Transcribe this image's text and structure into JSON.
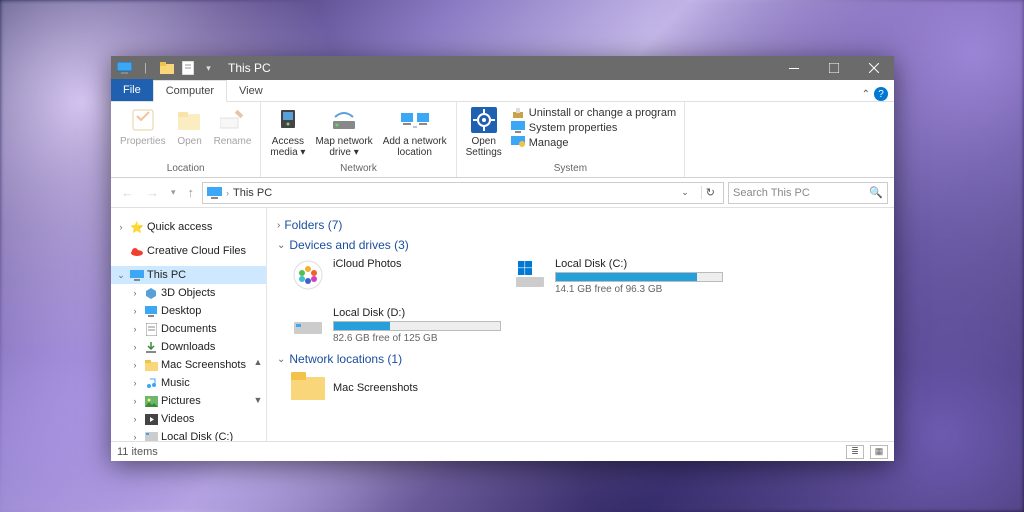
{
  "titlebar": {
    "title": "This PC"
  },
  "tabs": {
    "file": "File",
    "computer": "Computer",
    "view": "View"
  },
  "ribbon": {
    "location": {
      "label": "Location",
      "properties": "Properties",
      "open": "Open",
      "rename": "Rename"
    },
    "network": {
      "label": "Network",
      "access_media": "Access\nmedia ▾",
      "map_drive": "Map network\ndrive ▾",
      "add_location": "Add a network\nlocation"
    },
    "system": {
      "label": "System",
      "open_settings": "Open\nSettings",
      "uninstall": "Uninstall or change a program",
      "properties": "System properties",
      "manage": "Manage"
    }
  },
  "address": {
    "path": "This PC",
    "search_placeholder": "Search This PC"
  },
  "sidebar": {
    "items": [
      {
        "label": "Quick access",
        "icon": "star"
      },
      {
        "label": "Creative Cloud Files",
        "icon": "cloud"
      },
      {
        "label": "This PC",
        "icon": "pc"
      },
      {
        "label": "3D Objects",
        "icon": "3d"
      },
      {
        "label": "Desktop",
        "icon": "desktop"
      },
      {
        "label": "Documents",
        "icon": "docs"
      },
      {
        "label": "Downloads",
        "icon": "down"
      },
      {
        "label": "Mac Screenshots",
        "icon": "folder"
      },
      {
        "label": "Music",
        "icon": "music"
      },
      {
        "label": "Pictures",
        "icon": "pic"
      },
      {
        "label": "Videos",
        "icon": "vid"
      },
      {
        "label": "Local Disk (C:)",
        "icon": "disk"
      }
    ]
  },
  "sections": {
    "folders": {
      "title": "Folders (7)"
    },
    "devices": {
      "title": "Devices and drives (3)",
      "items": [
        {
          "name": "iCloud Photos",
          "sub": "",
          "fill": 0,
          "kind": "icloud"
        },
        {
          "name": "Local Disk (C:)",
          "sub": "14.1 GB free of 96.3 GB",
          "fill": 85,
          "kind": "os"
        },
        {
          "name": "Local Disk (D:)",
          "sub": "82.6 GB free of 125 GB",
          "fill": 34,
          "kind": "hdd"
        }
      ]
    },
    "network": {
      "title": "Network locations (1)",
      "items": [
        {
          "name": "Mac Screenshots"
        }
      ]
    }
  },
  "status": {
    "text": "11 items"
  }
}
